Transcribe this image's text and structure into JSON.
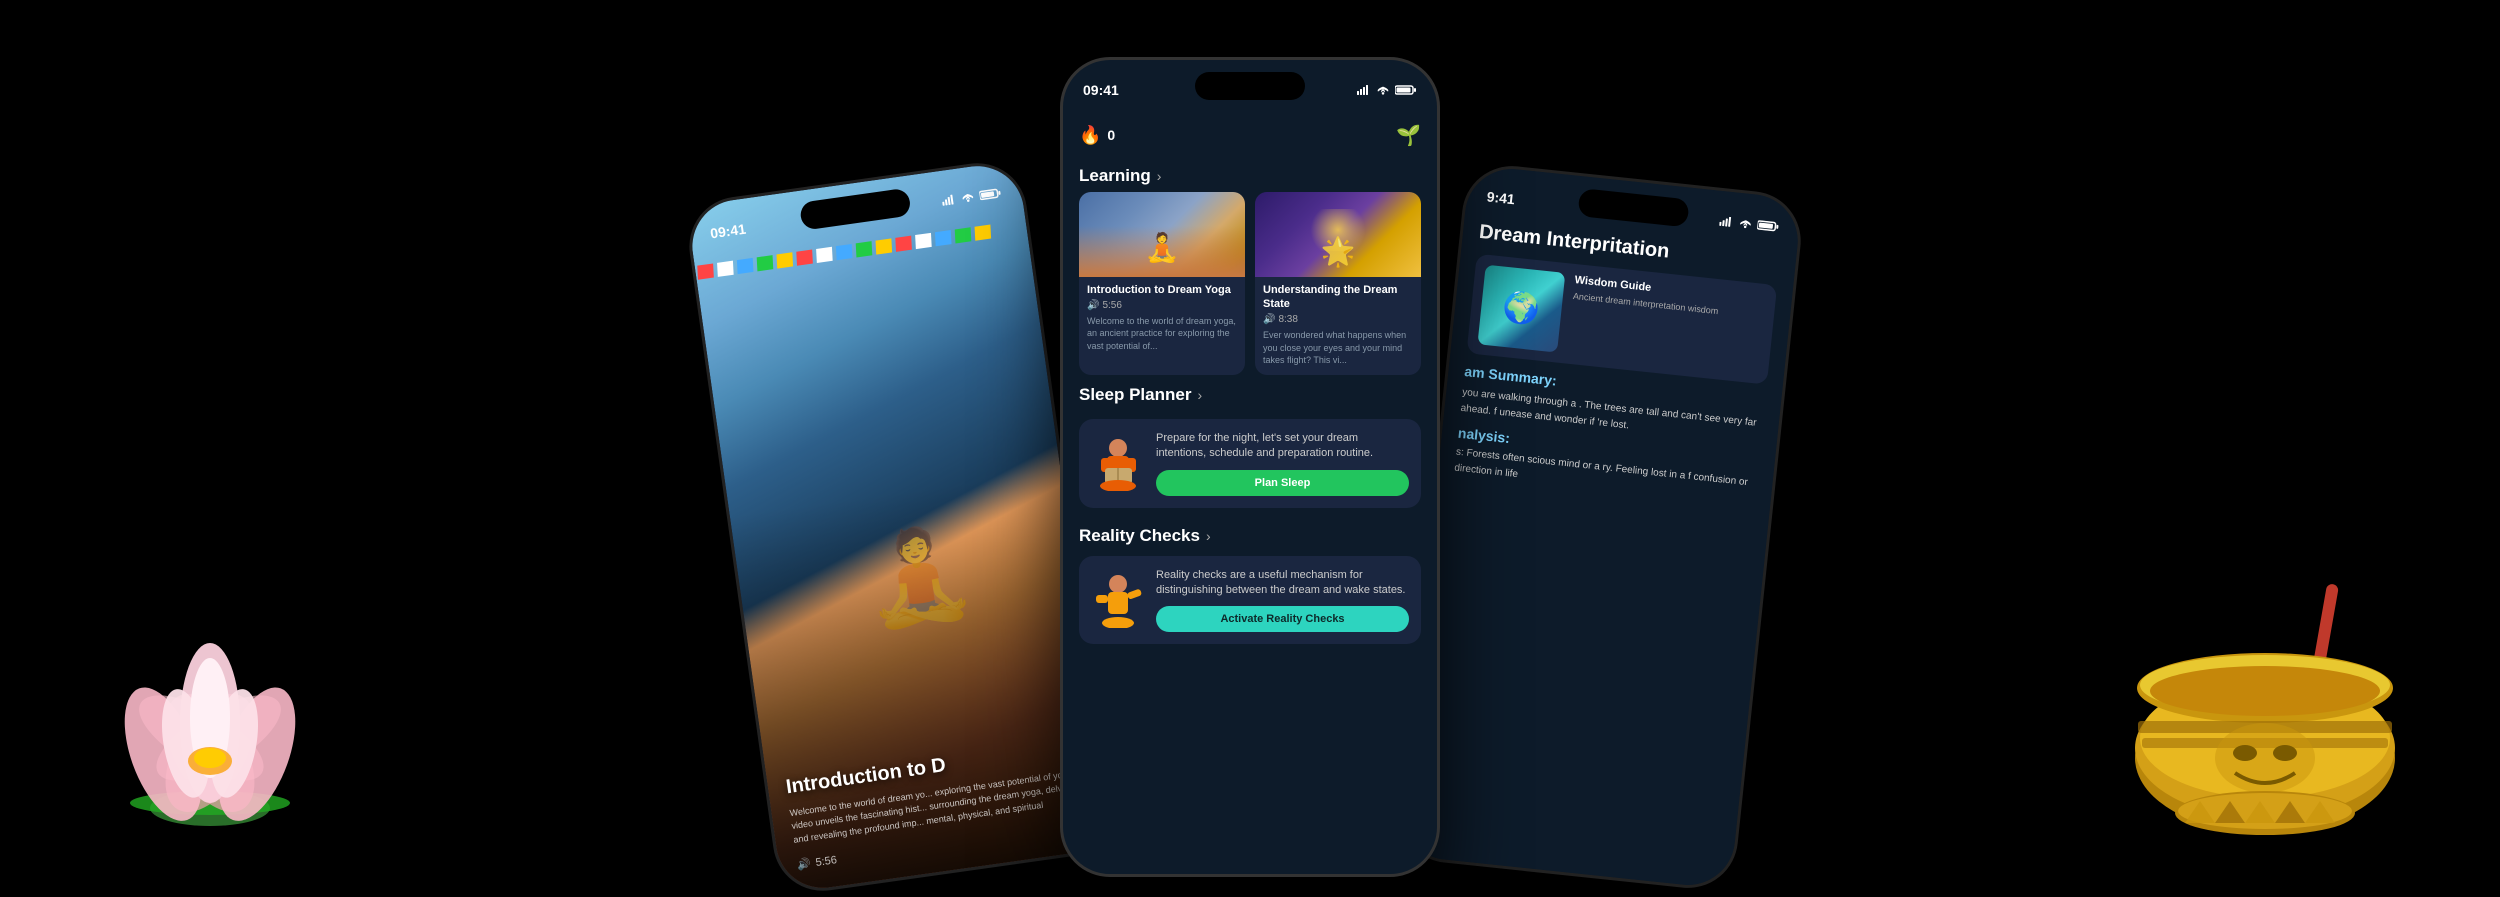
{
  "scene": {
    "background": "#000"
  },
  "phone_left": {
    "status": {
      "time": "09:41",
      "signal": true,
      "wifi": true
    },
    "hero_title": "Introduction to D",
    "hero_desc": "Welcome to the world of dream yo... exploring the vast potential of yo... video unveils the fascinating hist... surrounding the dream yoga, delvi... and revealing the profound imp... mental, physical, and spiritual",
    "duration": "5:56"
  },
  "phone_center": {
    "status": {
      "time": "09:41",
      "signal": true,
      "wifi": true,
      "battery": true
    },
    "header": {
      "flame_count": "0",
      "leaf": "🌱"
    },
    "learning_section": {
      "title": "Learning",
      "chevron": "›",
      "card1": {
        "title": "Introduction to Dream Yoga",
        "duration": "5:56",
        "desc": "Welcome to the world of dream yoga, an ancient practice for exploring the vast potential of..."
      },
      "card2": {
        "title": "Understanding the Dream State",
        "duration": "8:38",
        "desc": "Ever wondered what happens when you close your eyes and your mind takes flight? This vi..."
      }
    },
    "sleep_planner": {
      "title": "Sleep Planner",
      "chevron": "›",
      "desc": "Prepare for the night, let's set your dream intentions, schedule and preparation routine.",
      "button_label": "Plan Sleep"
    },
    "reality_checks": {
      "title": "Reality Checks",
      "chevron": "›",
      "desc": "Reality checks are a useful mechanism for distinguishing between the dream and wake states.",
      "button_label": "Activate Reality Checks"
    }
  },
  "phone_right": {
    "status": {
      "time": "9:41",
      "signal": true,
      "wifi": true,
      "battery": true
    },
    "section_title": "Dream Interpritation",
    "dream_summary": {
      "title": "am Summary:",
      "text": "you are walking through a . The trees are tall and can't see very far ahead. f unease and wonder if 're lost."
    },
    "analysis": {
      "title": "nalysis:",
      "text": "s: Forests often scious mind or a ry. Feeling lost in a f confusion or direction in life"
    }
  },
  "icons": {
    "flame": "🔥",
    "leaf": "🌱",
    "sound": "🔊",
    "chevron_right": "›"
  }
}
